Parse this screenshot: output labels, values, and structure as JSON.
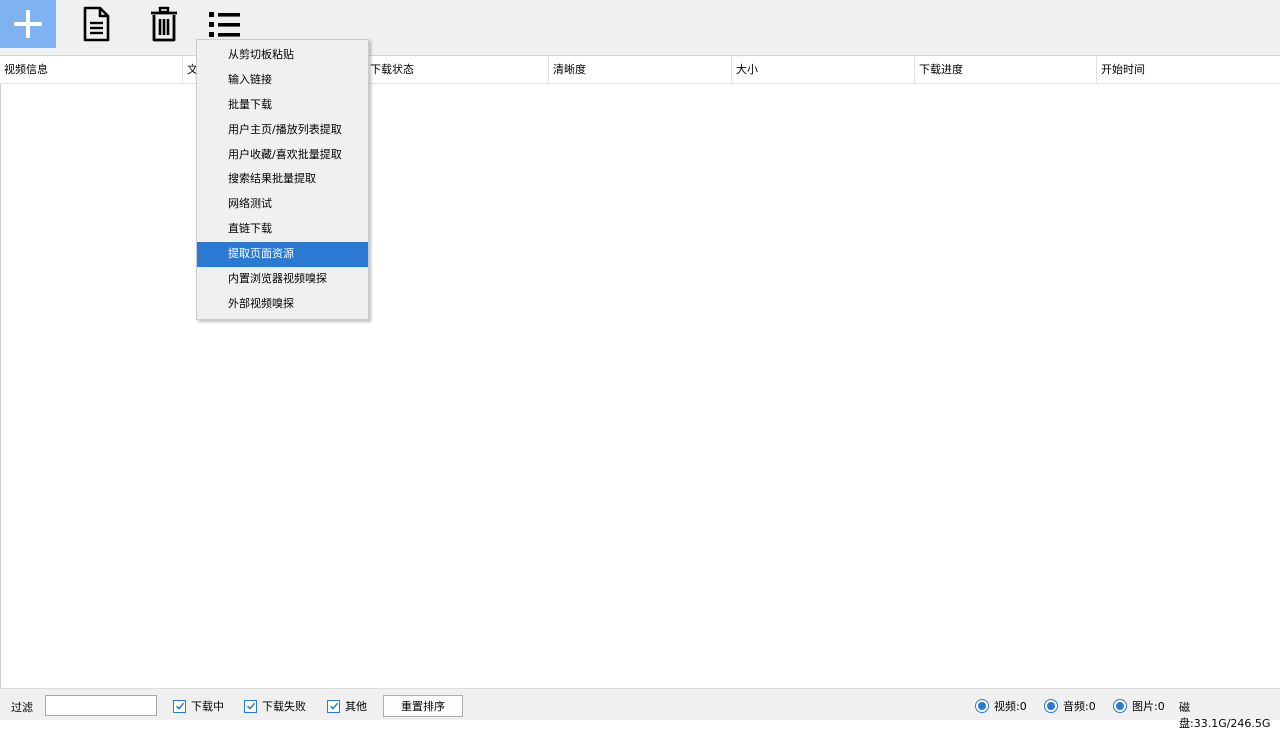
{
  "toolbar": {
    "add_icon": "plus-icon",
    "doc_icon": "document-icon",
    "delete_icon": "trash-icon",
    "list_icon": "list-icon",
    "accent_color": "#7fb2f0"
  },
  "table": {
    "columns": [
      "视频信息",
      "文",
      "下载状态",
      "清晰度",
      "大小",
      "下载进度",
      "开始时间"
    ]
  },
  "menu": {
    "items": [
      "从剪切板粘贴",
      "输入链接",
      "批量下载",
      "用户主页/播放列表提取",
      "用户收藏/喜欢批量提取",
      "搜索结果批量提取",
      "网络测试",
      "直链下载",
      "提取页面资源",
      "内置浏览器视频嗅探",
      "外部视频嗅探"
    ],
    "selected_index": 8,
    "highlight_color": "#2a7ad3"
  },
  "status": {
    "filter_label": "过滤",
    "filter_value": "",
    "checkboxes": [
      {
        "label": "下载中",
        "checked": true
      },
      {
        "label": "下载失败",
        "checked": true
      },
      {
        "label": "其他",
        "checked": true
      }
    ],
    "reset_sort": "重置排序",
    "radios": [
      {
        "label": "视频:0",
        "checked": true
      },
      {
        "label": "音频:0",
        "checked": true
      },
      {
        "label": "图片:0",
        "checked": true
      }
    ],
    "disk": "磁盘:33.1G/246.5G"
  }
}
